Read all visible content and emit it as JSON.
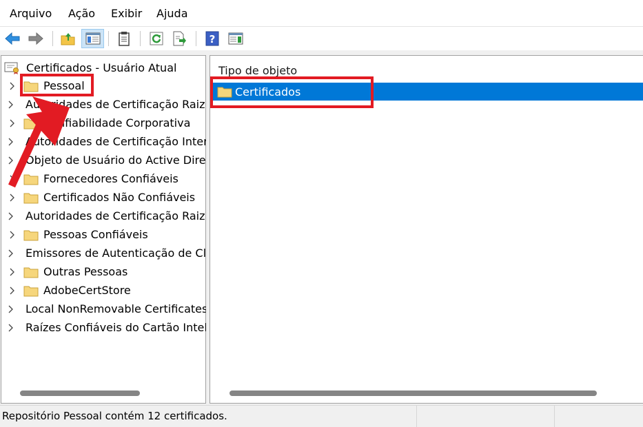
{
  "menu": {
    "items": [
      "Arquivo",
      "Ação",
      "Exibir",
      "Ajuda"
    ]
  },
  "toolbar": {
    "buttons": [
      {
        "icon": "back-arrow-icon"
      },
      {
        "icon": "forward-arrow-icon"
      },
      {
        "icon": "up-folder-icon"
      },
      {
        "icon": "show-hide-console-tree-icon",
        "pressed": true
      },
      {
        "icon": "clipboard-icon"
      },
      {
        "icon": "refresh-icon"
      },
      {
        "icon": "export-list-icon"
      },
      {
        "icon": "help-icon"
      },
      {
        "icon": "action-pane-icon"
      }
    ]
  },
  "tree": {
    "root_label": "Certificados - Usuário Atual",
    "items": [
      "Pessoal",
      "Autoridades de Certificação Raiz Confiáveis",
      "Confiabilidade Corporativa",
      "Autoridades de Certificação Intermediárias",
      "Objeto de Usuário do Active Directory",
      "Fornecedores Confiáveis",
      "Certificados Não Confiáveis",
      "Autoridades de Certificação Raiz de Terceiros",
      "Pessoas Confiáveis",
      "Emissores de Autenticação de Cliente",
      "Outras Pessoas",
      "AdobeCertStore",
      "Local NonRemovable Certificates",
      "Raízes Confiáveis do Cartão Inteligente"
    ]
  },
  "list": {
    "column_header": "Tipo de objeto",
    "rows": [
      "Certificados"
    ]
  },
  "status": {
    "text": "Repositório Pessoal contém 12 certificados."
  },
  "colors": {
    "selection": "#0078d7",
    "annotation": "#e21b23",
    "folder": "#f6d67c"
  }
}
